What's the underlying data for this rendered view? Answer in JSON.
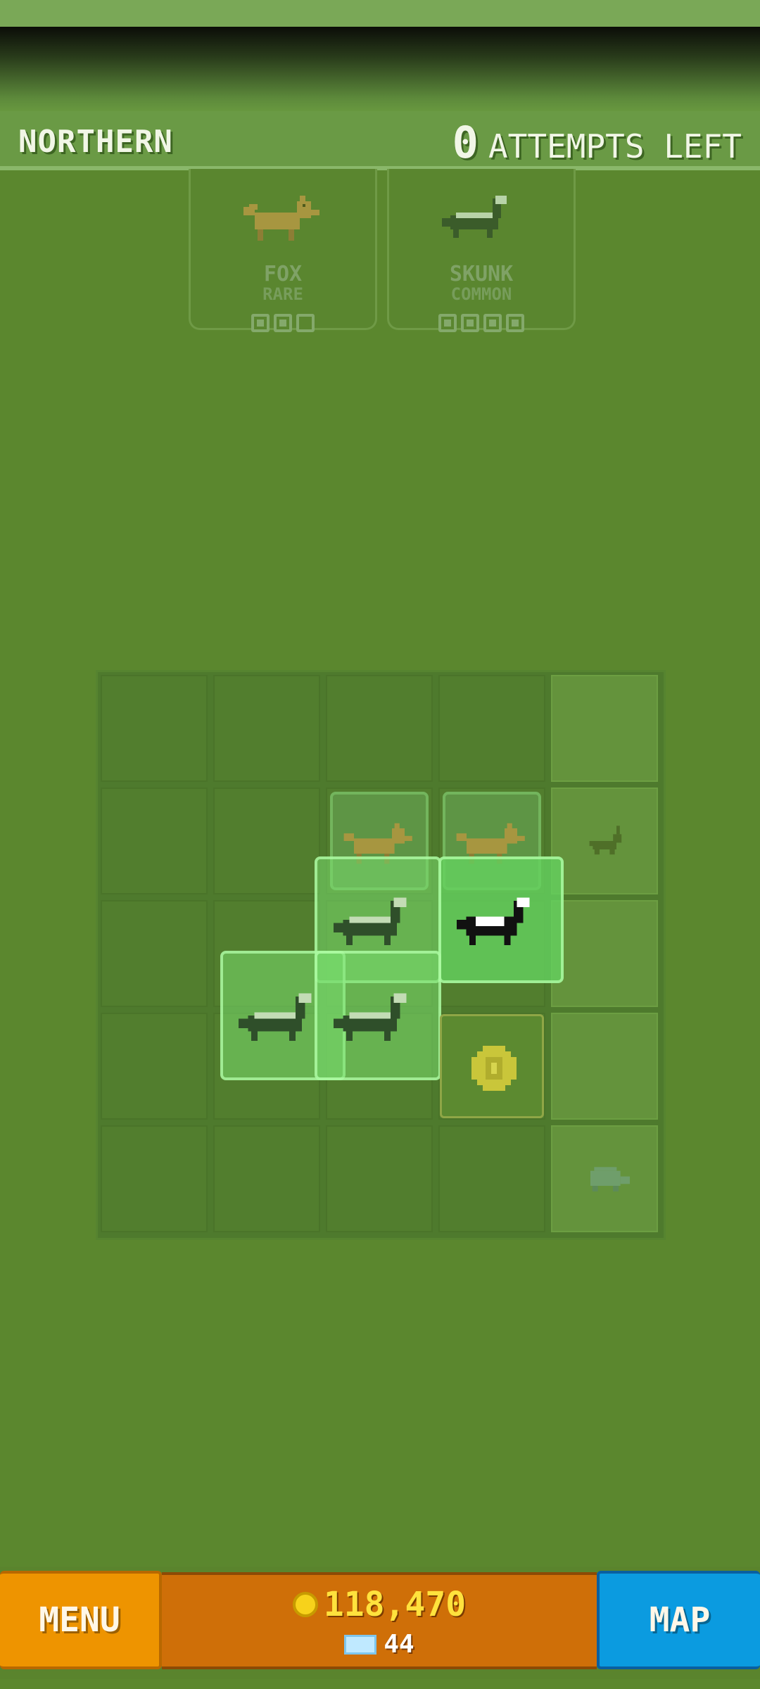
{
  "header": {
    "region_name": "NORTHERN",
    "attempts_count": "0",
    "attempts_label": "ATTEMPTS LEFT"
  },
  "targets": [
    {
      "animal": "FOX",
      "rarity": "RARE",
      "slots": 3,
      "found": 0,
      "icon": "fox-icon"
    },
    {
      "animal": "SKUNK",
      "rarity": "COMMON",
      "slots": 4,
      "found": 0,
      "icon": "skunk-icon"
    }
  ],
  "bottom": {
    "menu_label": "MENU",
    "map_label": "MAP",
    "coins": "118,470",
    "gems": "44"
  },
  "colors": {
    "background": "#5b872e",
    "menu_button": "#ee9400",
    "map_button": "#0b9be0",
    "currency_panel": "#cf6f08",
    "coin_text": "#ffe23d"
  }
}
